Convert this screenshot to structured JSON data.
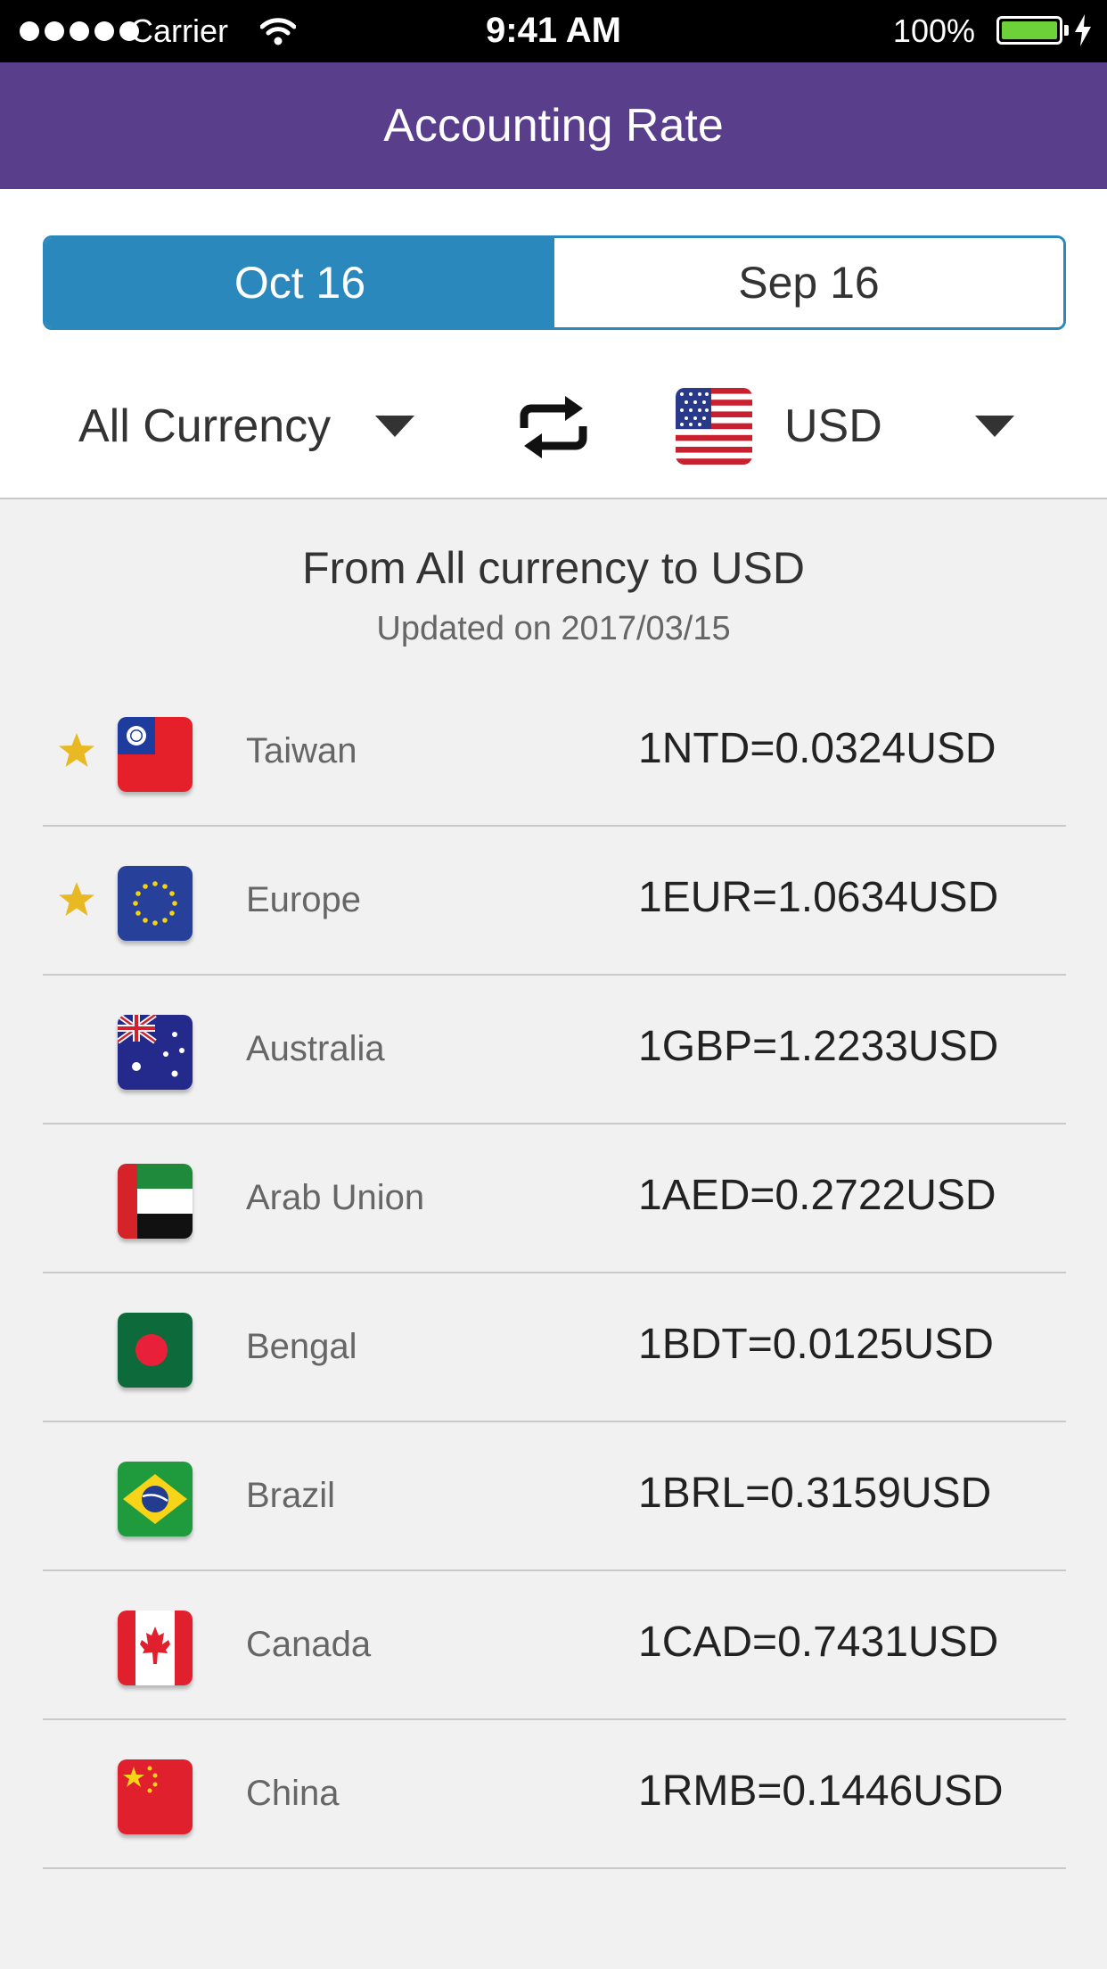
{
  "status_bar": {
    "carrier": "Carrier",
    "time": "9:41 AM",
    "battery": "100%"
  },
  "header": {
    "title": "Accounting Rate"
  },
  "tabs": [
    {
      "label": "Oct 16",
      "active": true
    },
    {
      "label": "Sep 16",
      "active": false
    }
  ],
  "from_currency": {
    "label": "All Currency"
  },
  "to_currency": {
    "code": "USD",
    "flag": "us-flag-icon"
  },
  "summary": {
    "title": "From All currency to USD",
    "updated": "Updated on 2017/03/15"
  },
  "rates": [
    {
      "country": "Taiwan",
      "rate": "1NTD=0.0324USD",
      "starred": true,
      "flag": "taiwan-flag-icon"
    },
    {
      "country": "Europe",
      "rate": "1EUR=1.0634USD",
      "starred": true,
      "flag": "eu-flag-icon"
    },
    {
      "country": "Australia",
      "rate": "1GBP=1.2233USD",
      "starred": false,
      "flag": "australia-flag-icon"
    },
    {
      "country": "Arab Union",
      "rate": "1AED=0.2722USD",
      "starred": false,
      "flag": "uae-flag-icon"
    },
    {
      "country": "Bengal",
      "rate": "1BDT=0.0125USD",
      "starred": false,
      "flag": "bangladesh-flag-icon"
    },
    {
      "country": "Brazil",
      "rate": "1BRL=0.3159USD",
      "starred": false,
      "flag": "brazil-flag-icon"
    },
    {
      "country": "Canada",
      "rate": "1CAD=0.7431USD",
      "starred": false,
      "flag": "canada-flag-icon"
    },
    {
      "country": "China",
      "rate": "1RMB=0.1446USD",
      "starred": false,
      "flag": "china-flag-icon"
    }
  ],
  "colors": {
    "header": "#593e8c",
    "accent": "#2a88bd",
    "star": "#e8b923"
  }
}
